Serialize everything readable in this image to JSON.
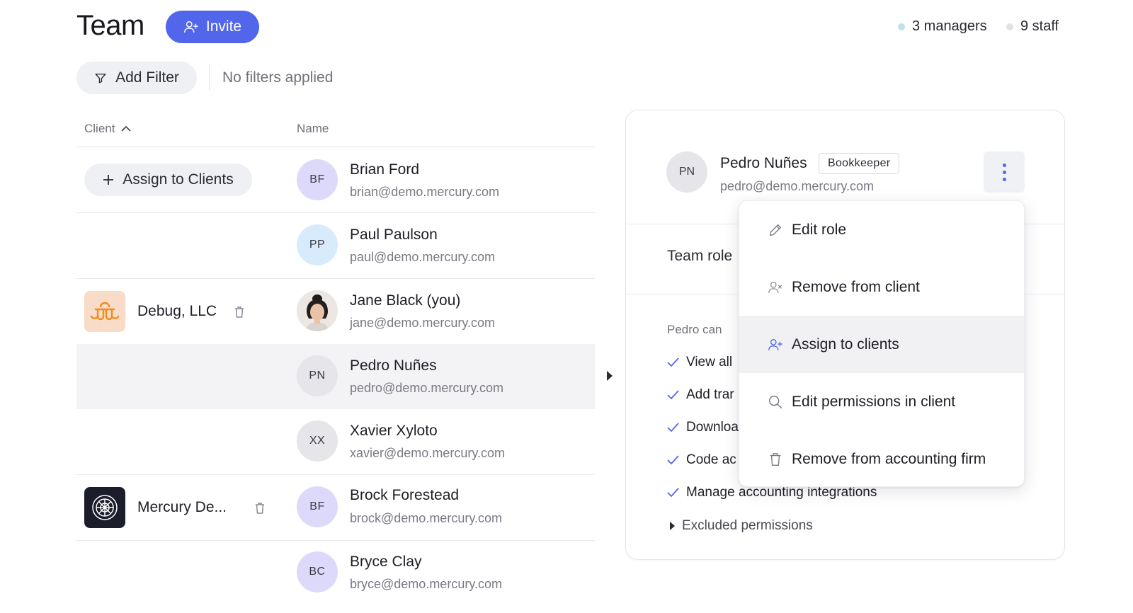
{
  "header": {
    "title": "Team",
    "invite_label": "Invite",
    "legend": [
      {
        "label": "3 managers",
        "color": "#bfe3ec"
      },
      {
        "label": "9 staff",
        "color": "#e2e2e6"
      }
    ]
  },
  "filters": {
    "add_filter_label": "Add Filter",
    "status": "No filters applied"
  },
  "table": {
    "columns": [
      "Client",
      "Name"
    ],
    "assign_label": "Assign to Clients",
    "clients": [
      {
        "name": "Debug, LLC"
      },
      {
        "name": "Mercury De..."
      }
    ],
    "people": [
      {
        "initials": "BF",
        "name": "Brian Ford",
        "email": "brian@demo.mercury.com",
        "avatar_color": "#ddd9fb"
      },
      {
        "initials": "PP",
        "name": "Paul Paulson",
        "email": "paul@demo.mercury.com",
        "avatar_color": "#d8ebfc"
      },
      {
        "initials": "",
        "name": "Jane Black (you)",
        "email": "jane@demo.mercury.com",
        "avatar_color": "#e9e4df"
      },
      {
        "initials": "PN",
        "name": "Pedro Nuñes",
        "email": "pedro@demo.mercury.com",
        "avatar_color": "#e5e5ea"
      },
      {
        "initials": "XX",
        "name": "Xavier Xyloto",
        "email": "xavier@demo.mercury.com",
        "avatar_color": "#e5e5ea"
      },
      {
        "initials": "BF",
        "name": "Brock Forestead",
        "email": "brock@demo.mercury.com",
        "avatar_color": "#ddd9fb"
      },
      {
        "initials": "BC",
        "name": "Bryce Clay",
        "email": "bryce@demo.mercury.com",
        "avatar_color": "#ddd9fb"
      }
    ]
  },
  "panel": {
    "initials": "PN",
    "name": "Pedro Nuñes",
    "role": "Bookkeeper",
    "email": "pedro@demo.mercury.com",
    "team_role_label": "Team role",
    "can_label": "Pedro can",
    "permissions": [
      "View all",
      "Add trar",
      "Downloa",
      "Code ac",
      "Manage accounting integrations"
    ],
    "excluded_label": "Excluded permissions"
  },
  "menu": {
    "items": [
      {
        "label": "Edit role",
        "icon": "pencil-icon"
      },
      {
        "label": "Remove from client",
        "icon": "user-remove-icon"
      },
      {
        "label": "Assign to clients",
        "icon": "user-add-icon"
      },
      {
        "label": "Edit permissions in client",
        "icon": "search-icon"
      },
      {
        "label": "Remove from accounting firm",
        "icon": "trash-icon"
      }
    ]
  },
  "colors": {
    "accent": "#5266eb",
    "selected_row": "#f3f3f5",
    "debug_logo_bg": "#f8dcc8",
    "debug_logo_fg": "#f28a1d",
    "mercury_logo_bg": "#1c1d2b"
  }
}
